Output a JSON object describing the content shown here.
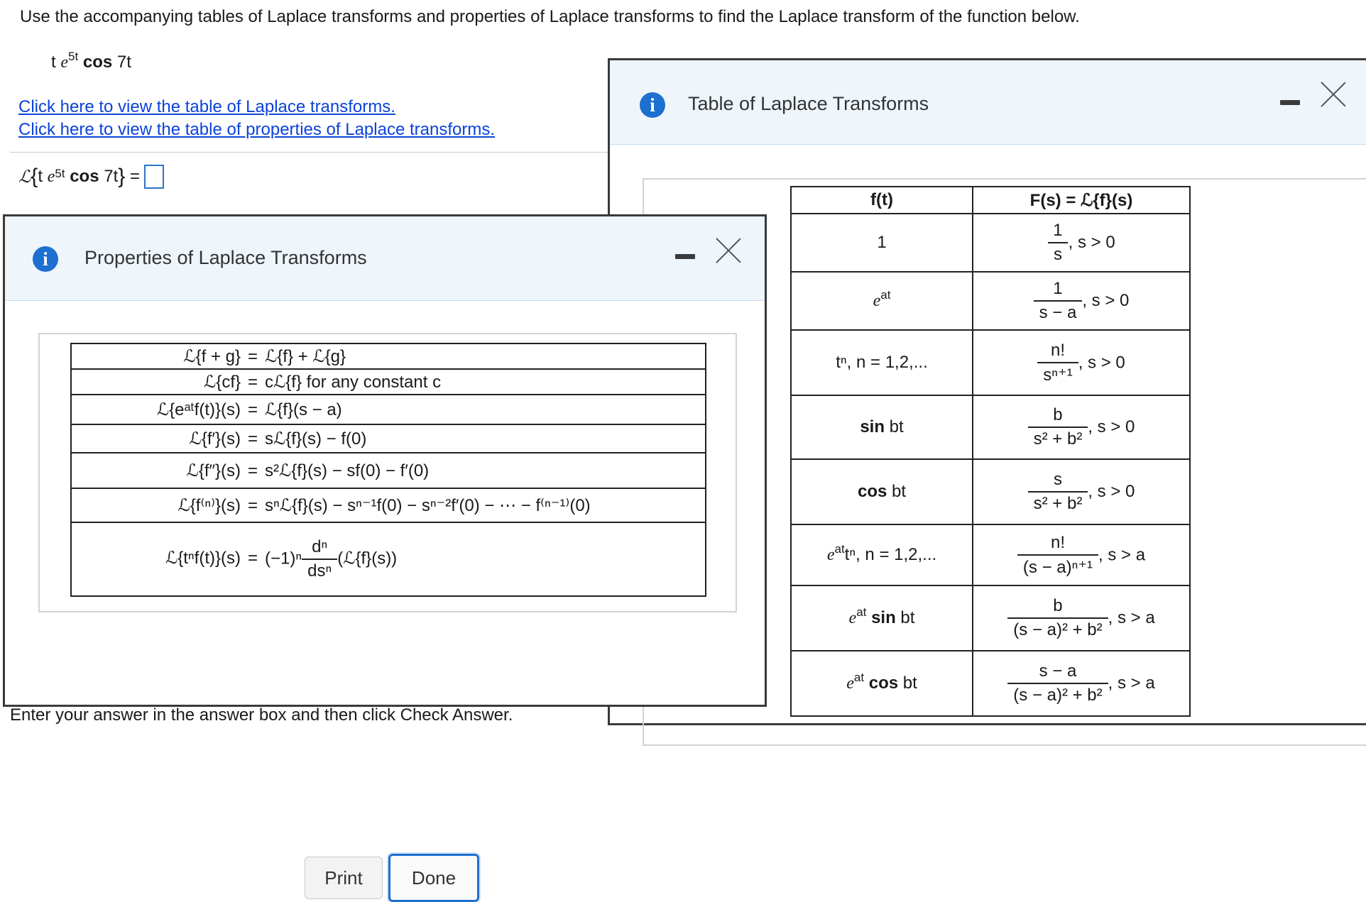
{
  "question": {
    "instruction": "Use the accompanying tables of Laplace transforms and properties of Laplace transforms to find the Laplace transform of the function below.",
    "function_display": {
      "t": "t",
      "e": "e",
      "exp": "5t",
      "trig": "cos",
      "arg": "7t"
    },
    "link_table": "Click here to view the table of Laplace transforms.",
    "link_properties": "Click here to view the table of properties of Laplace transforms.",
    "answer_prompt": {
      "L": "ℒ",
      "open": "{",
      "close": "}",
      "equals": "="
    },
    "bottom_text": "Enter your answer in the answer box and then click Check Answer."
  },
  "laplace_dialog": {
    "title": "Table of Laplace Transforms",
    "headers": {
      "ft": "f(t)",
      "Fs": "F(s) = ℒ{f}(s)"
    },
    "rows": [
      {
        "ft": "1",
        "num": "1",
        "den": "s",
        "cond": ", s > 0"
      },
      {
        "ft_e": "e",
        "ft_exp": "at",
        "num": "1",
        "den": "s − a",
        "cond": ", s > 0"
      },
      {
        "ft": "tⁿ, n = 1,2,...",
        "num": "n!",
        "den": "sⁿ⁺¹",
        "cond": ", s > 0"
      },
      {
        "ft_b": "sin",
        "ft_rest": " bt",
        "num": "b",
        "den": "s² + b²",
        "cond": ", s > 0"
      },
      {
        "ft_b": "cos",
        "ft_rest": " bt",
        "num": "s",
        "den": "s² + b²",
        "cond": ", s > 0"
      },
      {
        "ft_e": "e",
        "ft_exp": "at",
        "ft_rest": "tⁿ, n = 1,2,...",
        "num": "n!",
        "den": "(s − a)ⁿ⁺¹",
        "cond": ", s > a"
      },
      {
        "ft_e": "e",
        "ft_exp": "at",
        "ft_b": "sin",
        "ft_rest": " bt",
        "num": "b",
        "den": "(s − a)² + b²",
        "cond": ", s > a"
      },
      {
        "ft_e": "e",
        "ft_exp": "at",
        "ft_b": "cos",
        "ft_rest": " bt",
        "num": "s − a",
        "den": "(s − a)² + b²",
        "cond": ", s > a"
      }
    ]
  },
  "properties_dialog": {
    "title": "Properties of Laplace Transforms",
    "rows": [
      {
        "lhs": "ℒ{f + g}",
        "rhs": "ℒ{f} + ℒ{g}"
      },
      {
        "lhs": "ℒ{cf}",
        "rhs": "cℒ{f} for any constant c"
      },
      {
        "lhs": "ℒ{eᵃᵗf(t)}(s)",
        "rhs": "ℒ{f}(s − a)"
      },
      {
        "lhs": "ℒ{f′}(s)",
        "rhs": "sℒ{f}(s) − f(0)"
      },
      {
        "lhs": "ℒ{f″}(s)",
        "rhs": "s²ℒ{f}(s) − sf(0) − f′(0)"
      },
      {
        "lhs": "ℒ{f⁽ⁿ⁾}(s)",
        "rhs": "sⁿℒ{f}(s) − sⁿ⁻¹f(0) − sⁿ⁻²f′(0) − ⋯ − f⁽ⁿ⁻¹⁾(0)"
      },
      {
        "lhs": "ℒ{tⁿf(t)}(s)",
        "rhs_pre": "(−1)ⁿ",
        "rhs_num": "dⁿ",
        "rhs_den": "dsⁿ",
        "rhs_post": "(ℒ{f}(s))"
      }
    ],
    "buttons": {
      "print": "Print",
      "done": "Done"
    }
  },
  "icons": {
    "info": "i"
  },
  "colors": {
    "link": "#0b43d9",
    "accent": "#1d6fd0",
    "header_bg": "#eef5fb"
  }
}
